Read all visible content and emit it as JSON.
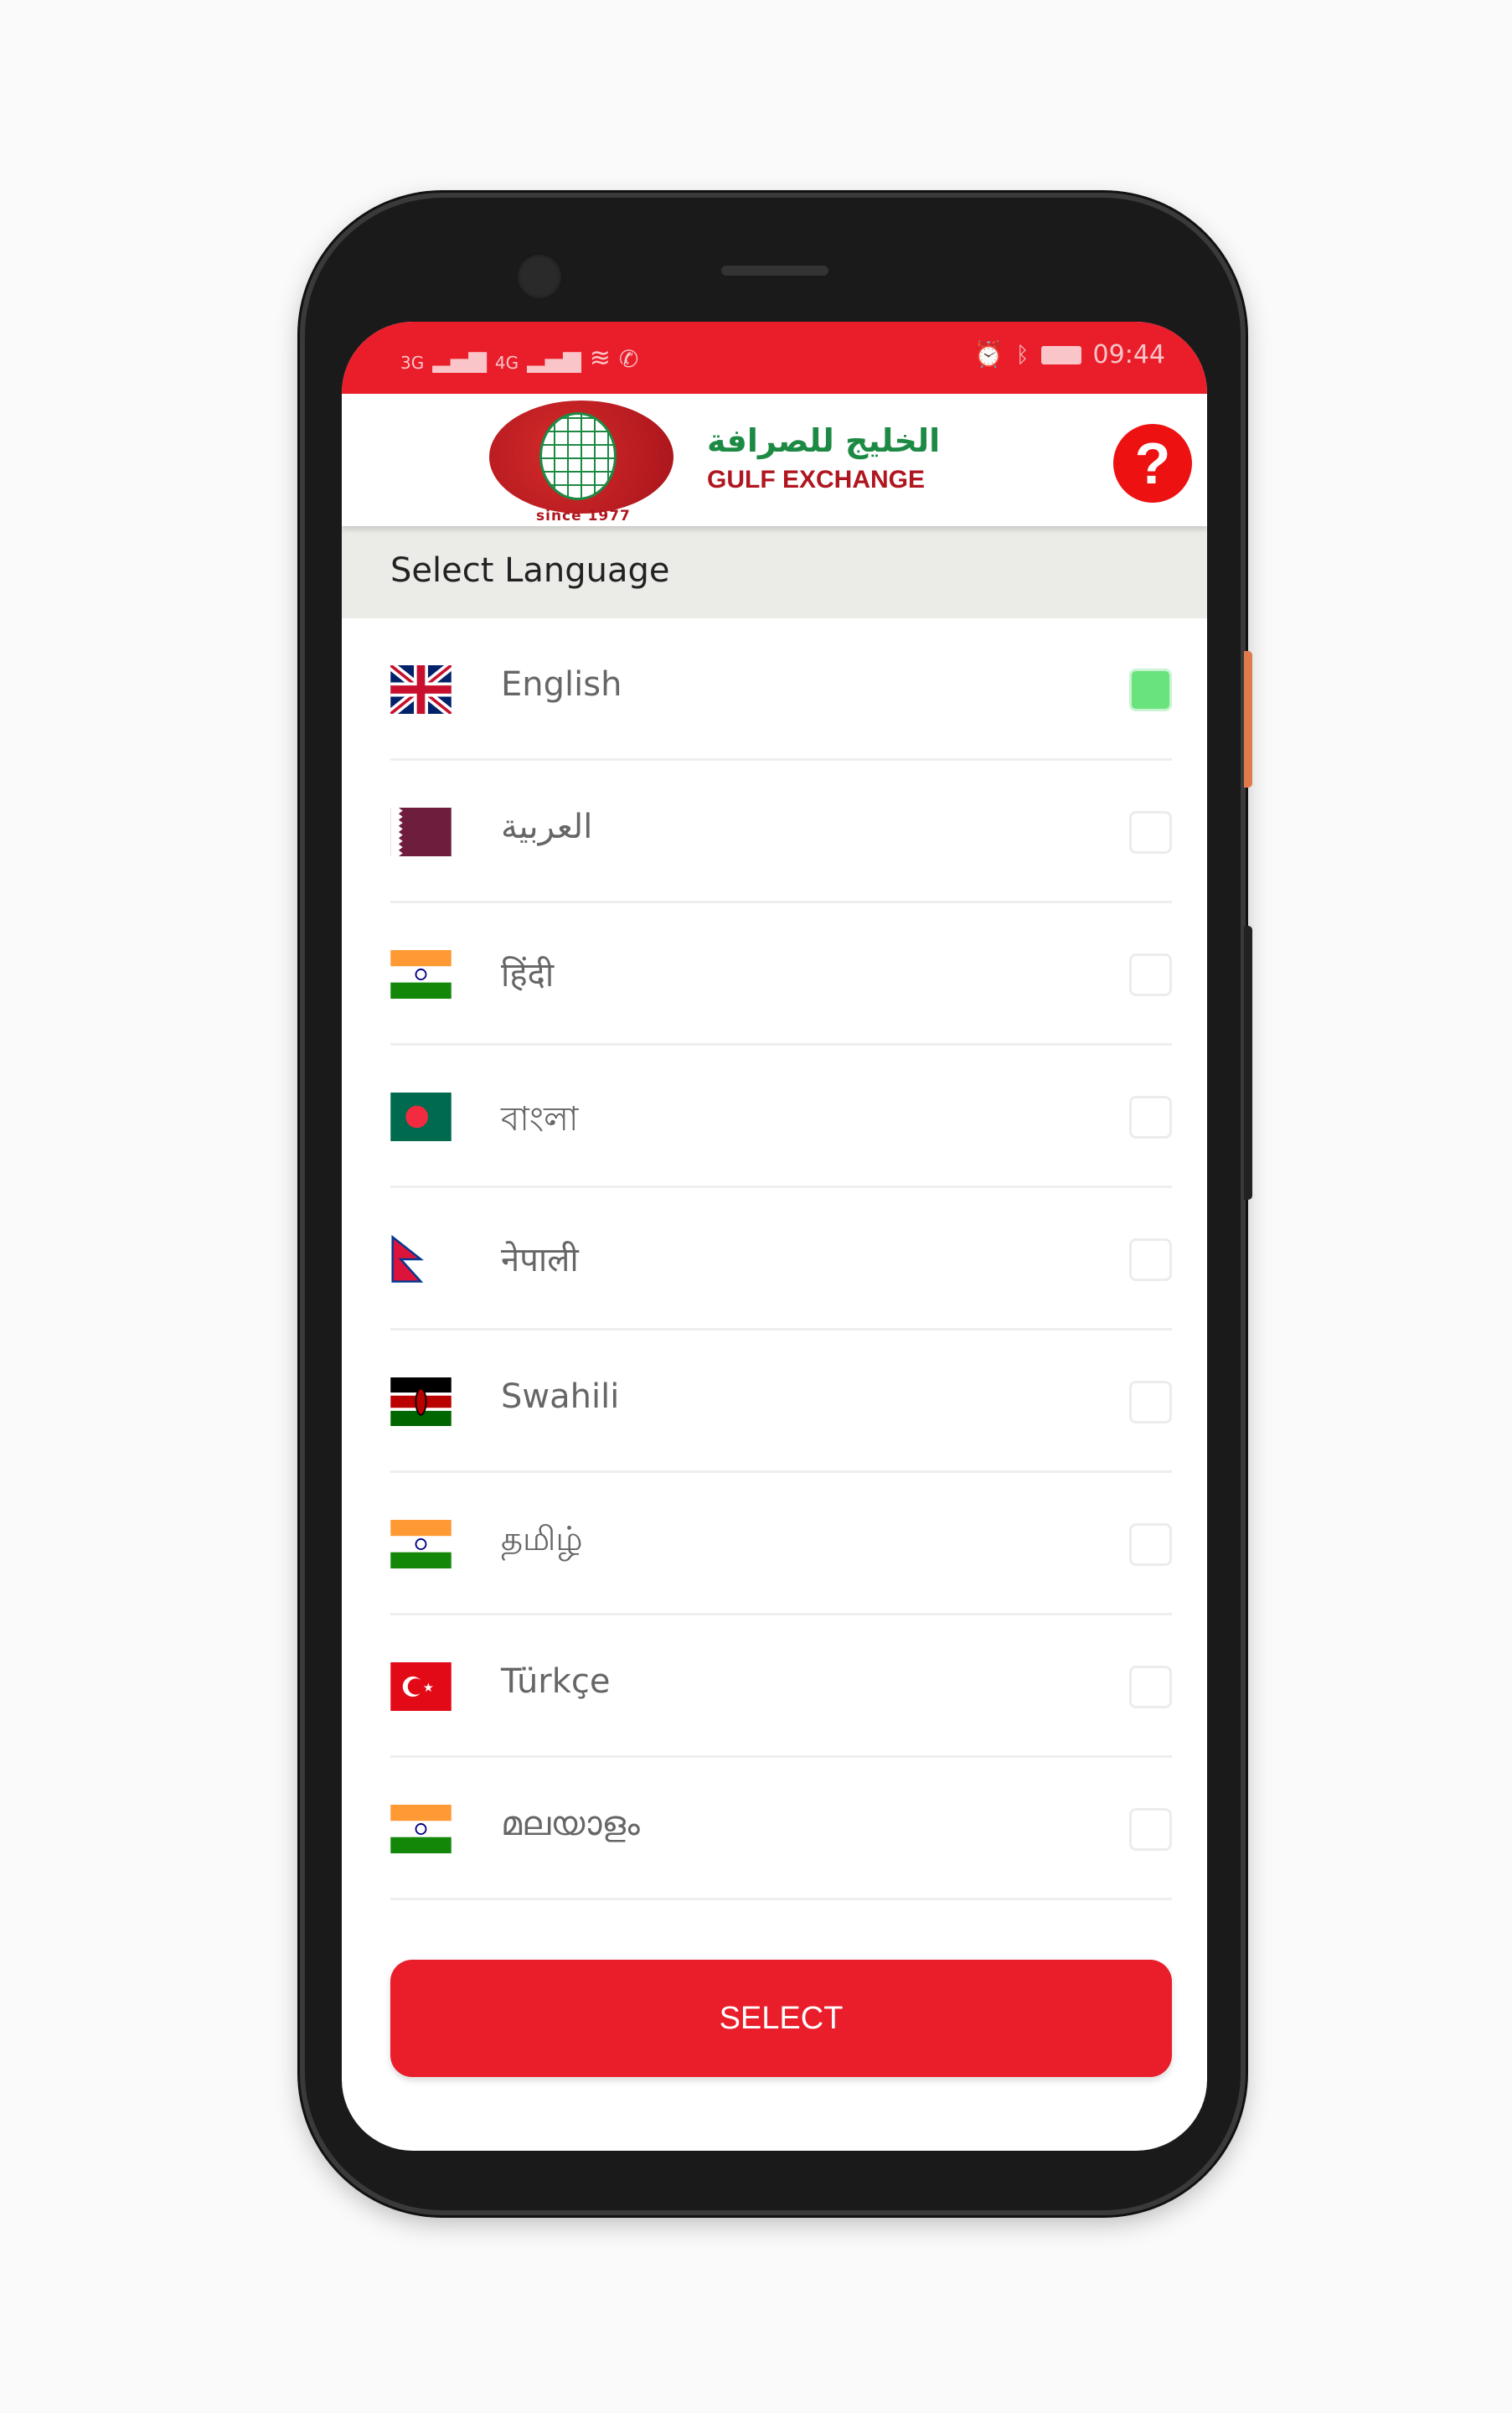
{
  "status_bar": {
    "network_1": "3G",
    "network_2": "4G",
    "time": "09:44",
    "icons": [
      "signal-icon",
      "signal-icon",
      "wifi-icon",
      "call-icon",
      "alarm-icon",
      "bluetooth-icon",
      "battery-icon"
    ]
  },
  "header": {
    "brand_arabic": "الخليج للصرافة",
    "brand_english": "GULF EXCHANGE",
    "since": "since 1977",
    "help_label": "?"
  },
  "section_title": "Select Language",
  "languages": [
    {
      "label": "English",
      "flag": "uk",
      "selected": true
    },
    {
      "label": "العربية",
      "flag": "qatar",
      "selected": false
    },
    {
      "label": "हिंदी",
      "flag": "india",
      "selected": false
    },
    {
      "label": "বাংলা",
      "flag": "bangladesh",
      "selected": false
    },
    {
      "label": "नेपाली",
      "flag": "nepal",
      "selected": false
    },
    {
      "label": "Swahili",
      "flag": "kenya",
      "selected": false
    },
    {
      "label": "தமிழ்",
      "flag": "india",
      "selected": false
    },
    {
      "label": "Türkçe",
      "flag": "turkey",
      "selected": false
    },
    {
      "label": "മലയാളം",
      "flag": "india",
      "selected": false
    }
  ],
  "select_button": "SELECT",
  "colors": {
    "primary": "#ea1d2a",
    "selected": "#68e37d",
    "brand_green": "#1d8a44"
  }
}
